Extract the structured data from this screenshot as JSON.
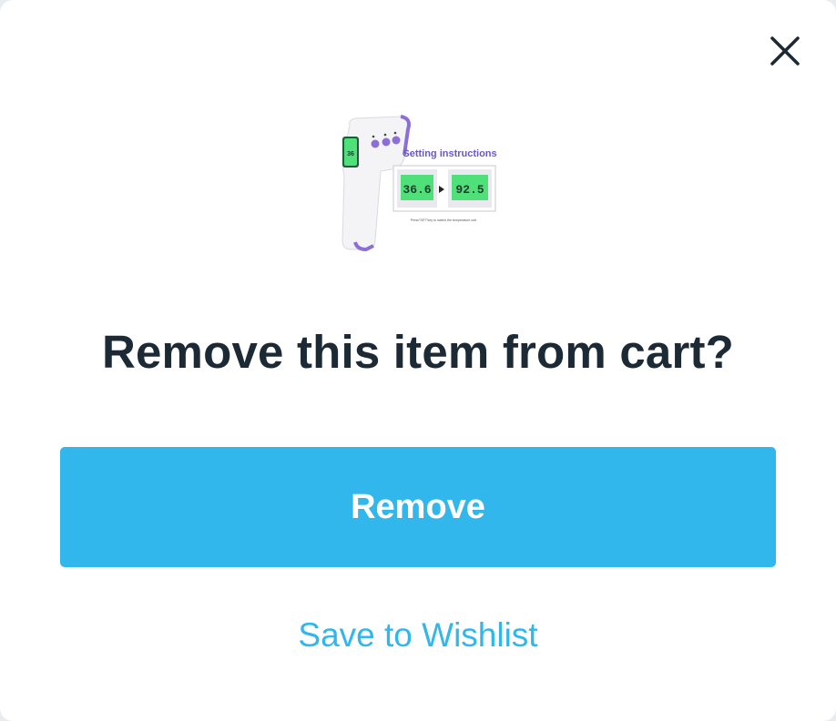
{
  "dialog": {
    "title": "Remove this item from cart?",
    "remove_label": "Remove",
    "wishlist_label": "Save to Wishlist",
    "close_icon": "close-icon"
  },
  "product": {
    "image_caption": "Setting instructions",
    "reading_celsius": "36.6",
    "reading_fahrenheit": "92.5",
    "footnote": "Press\"SET\"key to switch the temperature unit",
    "accent_color": "#8b6fd6",
    "display_color": "#4fe07a"
  },
  "colors": {
    "primary": "#31b7eb",
    "title_text": "#1b2a35",
    "background": "#ffffff"
  }
}
